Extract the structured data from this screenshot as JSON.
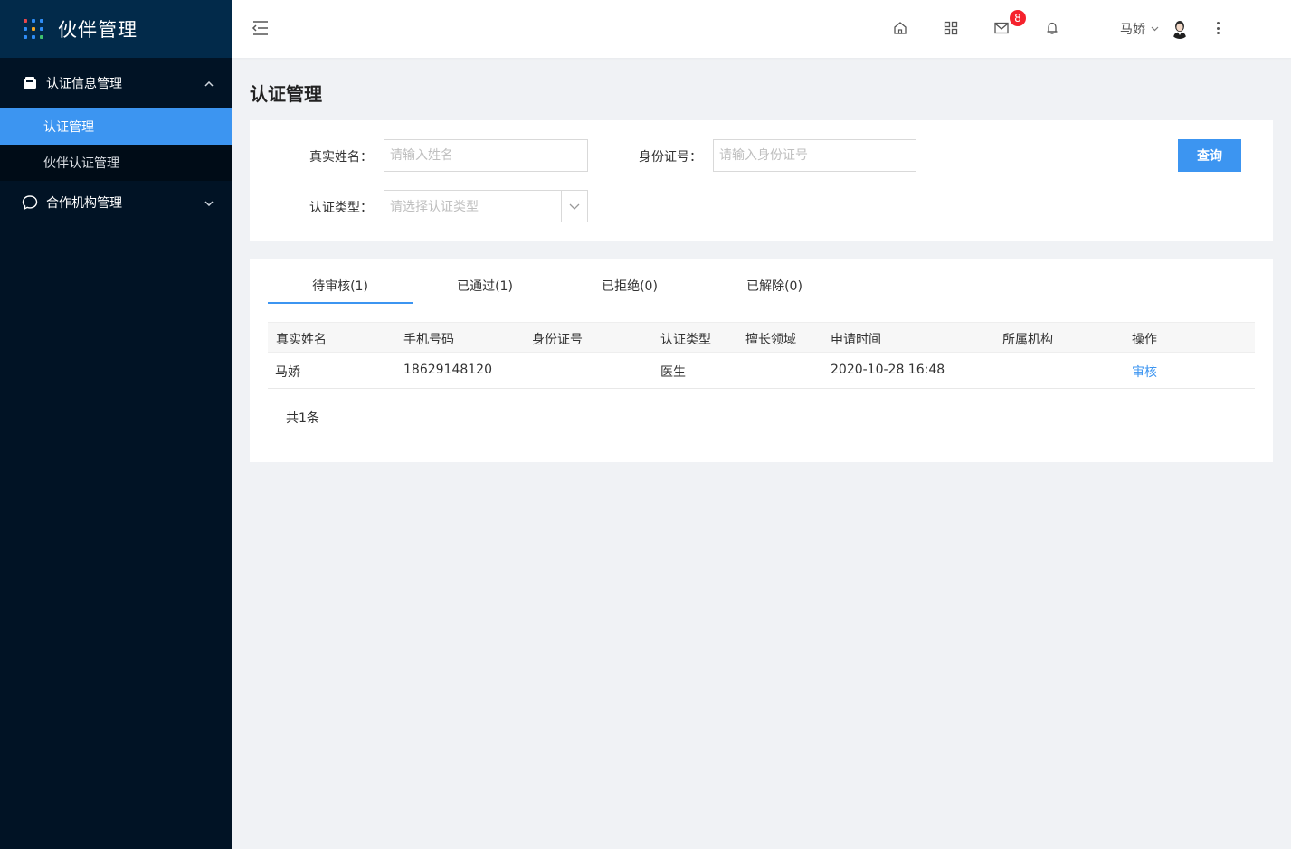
{
  "app": {
    "title": "伙伴管理"
  },
  "sidebar": {
    "groups": [
      {
        "label": "认证信息管理",
        "icon": "inbox-icon",
        "expanded": true,
        "items": [
          {
            "label": "认证管理",
            "active": true
          },
          {
            "label": "伙伴认证管理",
            "active": false
          }
        ]
      },
      {
        "label": "合作机构管理",
        "icon": "chat-icon",
        "expanded": false
      }
    ]
  },
  "header": {
    "icons": [
      "home-icon",
      "apps-icon",
      "mail-icon",
      "bell-icon"
    ],
    "mail_badge": "8",
    "user_name": "马娇"
  },
  "page": {
    "title": "认证管理"
  },
  "filters": {
    "name_label": "真实姓名：",
    "name_placeholder": "请输入姓名",
    "id_label": "身份证号：",
    "id_placeholder": "请输入身份证号",
    "type_label": "认证类型：",
    "type_placeholder": "请选择认证类型",
    "query_label": "查询"
  },
  "tabs": [
    {
      "label": "待审核(1)",
      "active": true
    },
    {
      "label": "已通过(1)",
      "active": false
    },
    {
      "label": "已拒绝(0)",
      "active": false
    },
    {
      "label": "已解除(0)",
      "active": false
    }
  ],
  "table": {
    "columns": [
      "真实姓名",
      "手机号码",
      "身份证号",
      "认证类型",
      "擅长领域",
      "申请时间",
      "所属机构",
      "操作"
    ],
    "rows": [
      {
        "name": "马娇",
        "phone": "18629148120",
        "id_number": "",
        "type": "医生",
        "specialty": "",
        "apply_time": "2020-10-28 16:48",
        "org": "",
        "action": "审核"
      }
    ]
  },
  "pagination": {
    "total": "共1条"
  },
  "colors": {
    "accent": "#3c95f1",
    "sidebar_bg": "#011325",
    "brand_bg": "#022a4a",
    "badge": "#f5222d"
  }
}
